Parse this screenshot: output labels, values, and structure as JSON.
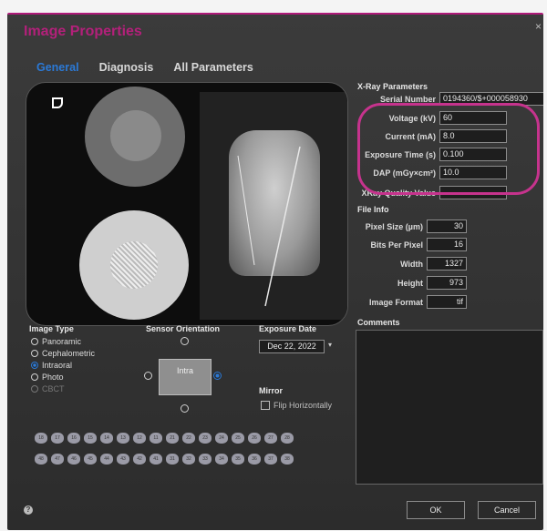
{
  "dialog": {
    "title": "Image Properties",
    "close": "×"
  },
  "tabs": [
    {
      "label": "General",
      "active": true
    },
    {
      "label": "Diagnosis",
      "active": false
    },
    {
      "label": "All Parameters",
      "active": false
    }
  ],
  "xray_params": {
    "heading": "X-Ray Parameters",
    "serial_label": "Serial Number",
    "serial_value": "0194360/$+000058930",
    "voltage_label": "Voltage (kV)",
    "voltage_value": "60",
    "current_label": "Current (mA)",
    "current_value": "8.0",
    "exposure_label": "Exposure Time (s)",
    "exposure_value": "0.100",
    "dap_label": "DAP (mGy×cm²)",
    "dap_value": "10.0",
    "quality_label": "XRay Quality Value",
    "quality_value": ""
  },
  "file_info": {
    "heading": "File Info",
    "pixel_size_label": "Pixel Size (µm)",
    "pixel_size_value": "30",
    "bits_label": "Bits Per Pixel",
    "bits_value": "16",
    "width_label": "Width",
    "width_value": "1327",
    "height_label": "Height",
    "height_value": "973",
    "format_label": "Image Format",
    "format_value": "tif"
  },
  "comments": {
    "heading": "Comments",
    "value": ""
  },
  "image_type": {
    "heading": "Image Type",
    "options": [
      {
        "label": "Panoramic",
        "selected": false,
        "disabled": false
      },
      {
        "label": "Cephalometric",
        "selected": false,
        "disabled": false
      },
      {
        "label": "Intraoral",
        "selected": true,
        "disabled": false
      },
      {
        "label": "Photo",
        "selected": false,
        "disabled": false
      },
      {
        "label": "CBCT",
        "selected": false,
        "disabled": true
      }
    ]
  },
  "sensor": {
    "heading": "Sensor Orientation",
    "label": "Intra"
  },
  "exposure_date": {
    "heading": "Exposure Date",
    "value": "Dec 22, 2022"
  },
  "mirror": {
    "heading": "Mirror",
    "checkbox_label": "Flip Horizontally",
    "checked": false
  },
  "teeth_upper": [
    "18",
    "17",
    "16",
    "15",
    "14",
    "13",
    "12",
    "11",
    "21",
    "22",
    "23",
    "24",
    "25",
    "26",
    "27",
    "28"
  ],
  "teeth_lower": [
    "48",
    "47",
    "46",
    "45",
    "44",
    "43",
    "42",
    "41",
    "31",
    "32",
    "33",
    "34",
    "35",
    "36",
    "37",
    "38"
  ],
  "buttons": {
    "ok": "OK",
    "cancel": "Cancel"
  },
  "colors": {
    "accent": "#2b79d6",
    "title": "#b3207a",
    "highlight": "#c6338d"
  }
}
